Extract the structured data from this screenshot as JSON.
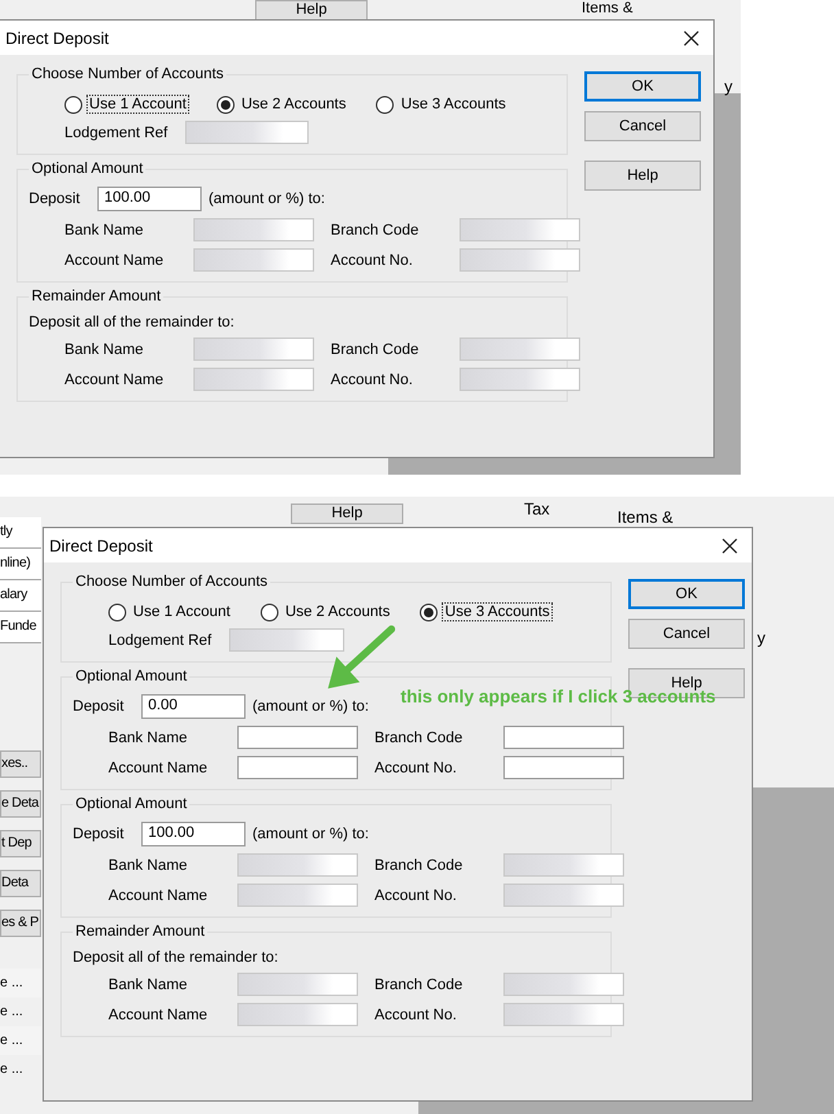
{
  "top_panel": {
    "background": {
      "help_button": "Help",
      "tile_label": "Items &",
      "tile_label_2": "y"
    },
    "dialog": {
      "title": "Direct Deposit",
      "buttons": [
        {
          "label": "OK",
          "kind": "default"
        },
        {
          "label": "Cancel",
          "kind": "normal"
        },
        {
          "label": "Help",
          "kind": "normal"
        }
      ],
      "groups": [
        {
          "kind": "choose",
          "title": "Choose Number of Accounts",
          "radios": [
            {
              "label": "Use 1 Account",
              "selected": false,
              "focused": true
            },
            {
              "label": "Use 2 Accounts",
              "selected": true,
              "focused": false
            },
            {
              "label": "Use 3 Accounts",
              "selected": false,
              "focused": false
            }
          ],
          "ref_label": "Lodgement Ref",
          "ref_blurred": true
        },
        {
          "kind": "amount",
          "title": "Optional Amount",
          "deposit_label": "Deposit",
          "deposit_value": "100.00",
          "deposit_suffix": "(amount or %) to:",
          "fields": [
            {
              "label": "Bank Name",
              "blurred": true
            },
            {
              "label": "Branch Code",
              "blurred": true
            },
            {
              "label": "Account Name",
              "blurred": true
            },
            {
              "label": "Account No.",
              "blurred": true
            }
          ]
        },
        {
          "kind": "remainder",
          "title": "Remainder Amount",
          "note": "Deposit all of the remainder to:",
          "fields": [
            {
              "label": "Bank Name",
              "blurred": true
            },
            {
              "label": "Branch Code",
              "blurred": true
            },
            {
              "label": "Account Name",
              "blurred": true
            },
            {
              "label": "Account No.",
              "blurred": true
            }
          ]
        }
      ]
    }
  },
  "bottom_panel": {
    "background": {
      "list_items": [
        "tly",
        "nline)",
        "alary",
        "Funde"
      ],
      "side_buttons": [
        "xes..",
        "e Deta",
        "t Dep",
        "Deta",
        "es & P"
      ],
      "table_cells": [
        "e ...",
        "e ...",
        "e ...",
        "e ..."
      ],
      "help_button": "Help",
      "tax_label": "Tax",
      "tile_label": "Items &",
      "tile_label_2": "y"
    },
    "dialog": {
      "title": "Direct Deposit",
      "buttons": [
        {
          "label": "OK",
          "kind": "default"
        },
        {
          "label": "Cancel",
          "kind": "normal"
        },
        {
          "label": "Help",
          "kind": "normal"
        }
      ],
      "groups": [
        {
          "kind": "choose",
          "title": "Choose Number of Accounts",
          "radios": [
            {
              "label": "Use 1 Account",
              "selected": false,
              "focused": false
            },
            {
              "label": "Use 2 Accounts",
              "selected": false,
              "focused": false
            },
            {
              "label": "Use 3 Accounts",
              "selected": true,
              "focused": true
            }
          ],
          "ref_label": "Lodgement Ref",
          "ref_blurred": true
        },
        {
          "kind": "amount",
          "title": "Optional Amount",
          "deposit_label": "Deposit",
          "deposit_value": "0.00",
          "deposit_suffix": "(amount or %) to:",
          "fields": [
            {
              "label": "Bank Name",
              "blurred": false
            },
            {
              "label": "Branch Code",
              "blurred": false
            },
            {
              "label": "Account Name",
              "blurred": false
            },
            {
              "label": "Account No.",
              "blurred": false
            }
          ]
        },
        {
          "kind": "amount",
          "title": "Optional Amount",
          "deposit_label": "Deposit",
          "deposit_value": "100.00",
          "deposit_suffix": "(amount or %) to:",
          "fields": [
            {
              "label": "Bank Name",
              "blurred": true
            },
            {
              "label": "Branch Code",
              "blurred": true
            },
            {
              "label": "Account Name",
              "blurred": true
            },
            {
              "label": "Account No.",
              "blurred": true
            }
          ]
        },
        {
          "kind": "remainder",
          "title": "Remainder Amount",
          "note": "Deposit all of the remainder to:",
          "fields": [
            {
              "label": "Bank Name",
              "blurred": true
            },
            {
              "label": "Branch Code",
              "blurred": true
            },
            {
              "label": "Account Name",
              "blurred": true
            },
            {
              "label": "Account No.",
              "blurred": true
            }
          ]
        }
      ]
    },
    "annotation": {
      "text": "this only appears if I click 3 accounts"
    }
  }
}
